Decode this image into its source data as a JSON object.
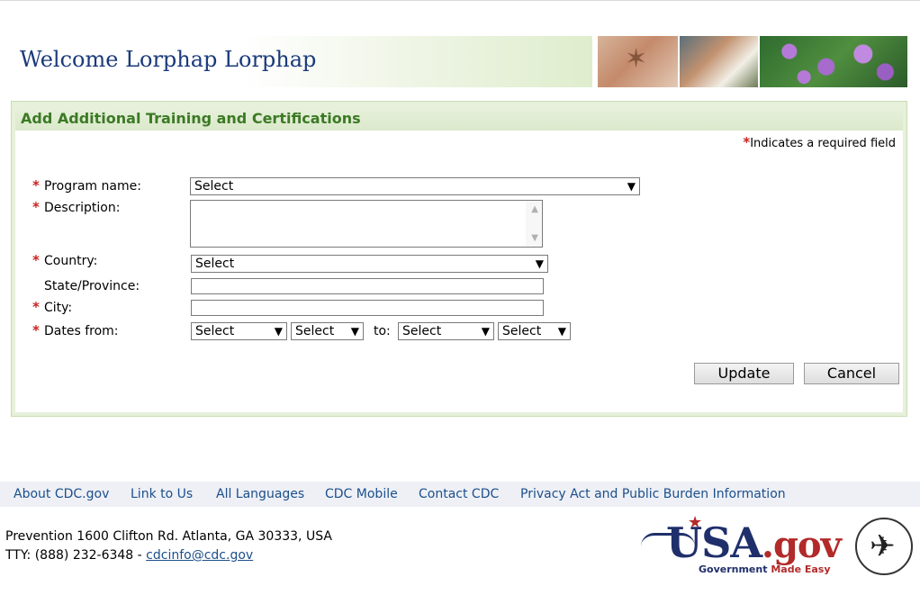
{
  "header": {
    "welcome": "Welcome Lorphap Lorphap",
    "images": [
      "mosquito-icon",
      "people-icon",
      "bacteria-icon"
    ]
  },
  "panel": {
    "title": "Add Additional Training and Certifications",
    "required_note": "Indicates a required field",
    "required_marker": "*"
  },
  "form": {
    "program_label": "Program name:",
    "program_value": "Select",
    "description_label": "Description:",
    "country_label": "Country:",
    "country_value": "Select",
    "state_label": "State/Province:",
    "city_label": "City:",
    "dates_label": "Dates from:",
    "from_month": "Select",
    "from_year": "Select",
    "to_label": "to:",
    "to_month": "Select",
    "to_year": "Select"
  },
  "buttons": {
    "update": "Update",
    "cancel": "Cancel"
  },
  "footer": {
    "links": [
      "About CDC.gov",
      "Link to Us",
      "All Languages",
      "CDC Mobile",
      "Contact CDC",
      "Privacy Act and Public Burden Information"
    ],
    "address": "Prevention   1600 Clifton Rd. Atlanta, GA 30333, USA",
    "tty": "TTY: (888) 232-6348 -",
    "email": "cdcinfo@cdc.gov",
    "usa_logo": {
      "usa": "USA",
      "gov": ".gov",
      "sub1": "Government",
      "sub2": "Made Easy"
    }
  },
  "colors": {
    "accent_green": "#3c7a25",
    "link_blue": "#1c4f8a",
    "required_red": "#cc2222"
  }
}
